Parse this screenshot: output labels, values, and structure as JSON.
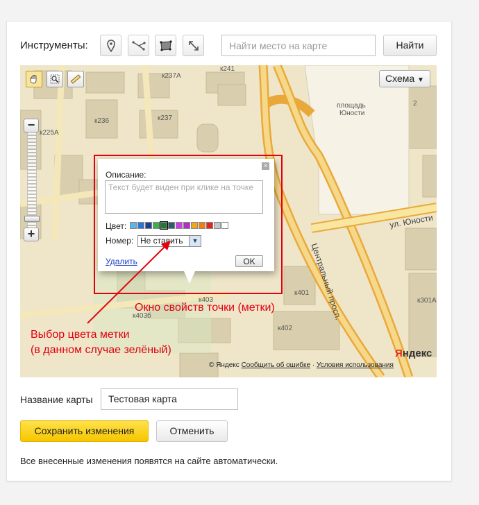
{
  "toolbar": {
    "label": "Инструменты:",
    "tools": [
      {
        "icon": "placemark-icon"
      },
      {
        "icon": "polyline-icon"
      },
      {
        "icon": "polygon-icon"
      },
      {
        "icon": "ruler-icon"
      }
    ],
    "search_placeholder": "Найти место на карте",
    "search_button": "Найти"
  },
  "map": {
    "type_button": "Схема",
    "labels": [
      "к237А",
      "к241",
      "к225А",
      "к236",
      "к237",
      "площадь",
      "Юности",
      "2",
      "к403",
      "к403б",
      "к401",
      "к402",
      "к301А",
      "Центральный просп.",
      "ул. Юности"
    ],
    "copyright": "© Яндекс",
    "report_link": "Сообщить об ошибке",
    "separator": "·",
    "terms_link": "Условия использования",
    "logo_main": "Я",
    "logo_rest": "ндекс",
    "colors": {
      "water_bg": "#efe6c9",
      "building": "#d9cfae",
      "road": "#f1d58d",
      "highway": "#e9a93a",
      "square": "#f6f2e6"
    }
  },
  "balloon": {
    "description_label": "Описание:",
    "description_placeholder": "Текст будет виден при клике на точке",
    "color_label": "Цвет:",
    "swatches": [
      "#5bb4ea",
      "#2c75d4",
      "#1e3c9a",
      "#37b34a",
      "#1f7a33",
      "#2f5a6a",
      "#c640e6",
      "#b52cc4",
      "#f2a619",
      "#f07d10",
      "#e4231d",
      "#c8c8c8",
      "#ffffff"
    ],
    "selected_swatch_index": 4,
    "number_label": "Номер:",
    "number_value": "Не ставить",
    "delete_link": "Удалить",
    "ok_button": "OK"
  },
  "annotations": {
    "window_note": "Окно свойств точки (метки)",
    "color_note_line1": "Выбор цвета метки",
    "color_note_line2": "(в данном случае зелёный)",
    "accent": "#e4000f"
  },
  "form": {
    "name_label": "Название карты",
    "name_value": "Тестовая карта",
    "save_button": "Сохранить изменения",
    "cancel_button": "Отменить",
    "note": "Все внесенные изменения появятся на сайте автоматически."
  }
}
